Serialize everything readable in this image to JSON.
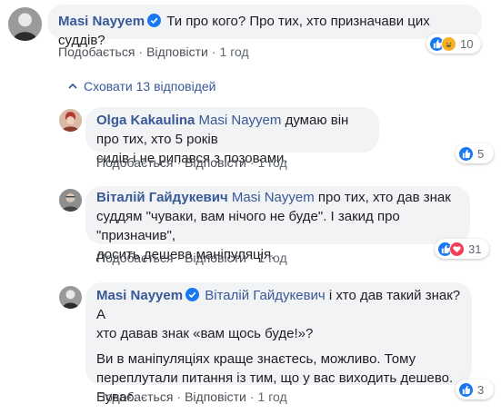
{
  "colors": {
    "link": "#385898",
    "bubble": "#f2f3f5",
    "meta": "#606770",
    "like_blue": "#1877f2",
    "love_red": "#f33e58",
    "haha_yellow": "#f7b125"
  },
  "comment": {
    "author": "Masi Nayyem",
    "text": "Ти про кого? Про тих, хто призначави цих суддів?",
    "like": "Подобається",
    "reply": "Відповісти",
    "time": "1 год",
    "reactions": {
      "icons": [
        "like-icon",
        "haha-icon"
      ],
      "count": "10"
    }
  },
  "replies_toggle": "Сховати 13 відповідей",
  "replies": [
    {
      "author": "Olga Kakaulina",
      "mention": "Masi Nayyem",
      "text_line1": "думаю він про тих, хто 5 років",
      "text_line2": "сидів і не рипався з позовами.",
      "like": "Подобається",
      "reply": "Відповісти",
      "time": "1 год",
      "reactions": {
        "icons": [
          "like-icon"
        ],
        "count": "5"
      }
    },
    {
      "author": "Віталій Гайдукевич",
      "mention": "Masi Nayyem",
      "text_line1": "про тих, хто дав знак",
      "text_line2": "суддям \"чуваки, вам нічого не буде\". І закид про \"призначив\",",
      "text_line3": "досить дешева маніпуляція.",
      "like": "Подобається",
      "reply": "Відповісти",
      "time": "1 год",
      "reactions": {
        "icons": [
          "like-icon",
          "love-icon"
        ],
        "count": "31"
      }
    },
    {
      "author": "Masi Nayyem",
      "mention": "Віталій Гайдукевич",
      "text_line1": "і хто дав такий знак? А",
      "text_line2": "хто давав знак «вам щось буде!»?",
      "para2_line1": "Ви в маніпуляціях краще знаєтесь, можливо. Тому",
      "para2_line2": "переплутали питання із тим, що у вас виходить дешево.",
      "para2_line3": "Буває.",
      "like": "Подобається",
      "reply": "Відповісти",
      "time": "1 год",
      "reactions": {
        "icons": [
          "like-icon"
        ],
        "count": "3"
      }
    }
  ]
}
